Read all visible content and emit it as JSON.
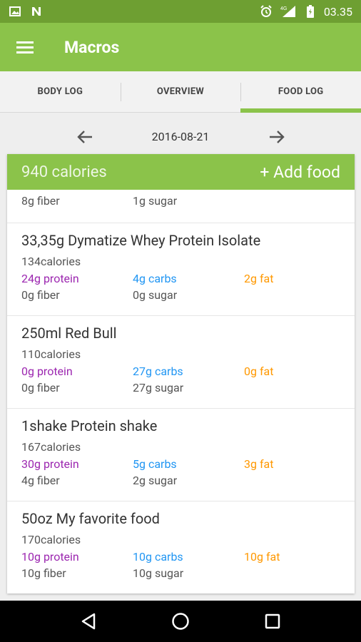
{
  "status": {
    "time": "03.35",
    "network": "4G"
  },
  "app": {
    "title": "Macros"
  },
  "tabs": [
    {
      "label": "BODY LOG"
    },
    {
      "label": "OVERVIEW"
    },
    {
      "label": "FOOD LOG"
    }
  ],
  "date": "2016-08-21",
  "summary": {
    "calories": "940 calories",
    "add_label": "+ Add food"
  },
  "entries": [
    {
      "fiber": "8g fiber",
      "sugar": "1g sugar"
    },
    {
      "title": "33,35g  Dymatize Whey Protein Isolate",
      "calories": "134calories",
      "protein": "24g protein",
      "carbs": "4g carbs",
      "fat": "2g fat",
      "fiber": "0g fiber",
      "sugar": "0g sugar"
    },
    {
      "title": "250ml  Red Bull",
      "calories": "110calories",
      "protein": "0g protein",
      "carbs": "27g carbs",
      "fat": "0g fat",
      "fiber": "0g fiber",
      "sugar": "27g sugar"
    },
    {
      "title": "1shake  Protein shake",
      "calories": "167calories",
      "protein": "30g protein",
      "carbs": "5g carbs",
      "fat": "3g fat",
      "fiber": "4g fiber",
      "sugar": "2g sugar"
    },
    {
      "title": "50oz  My favorite food",
      "calories": "170calories",
      "protein": "10g protein",
      "carbs": "10g carbs",
      "fat": "10g fat",
      "fiber": "10g fiber",
      "sugar": "10g sugar"
    }
  ],
  "colors": {
    "primary": "#8bc34a",
    "primary_dark": "#6e9f32",
    "protein": "#9c27b0",
    "carbs": "#2196f3",
    "fat": "#ff9800"
  }
}
